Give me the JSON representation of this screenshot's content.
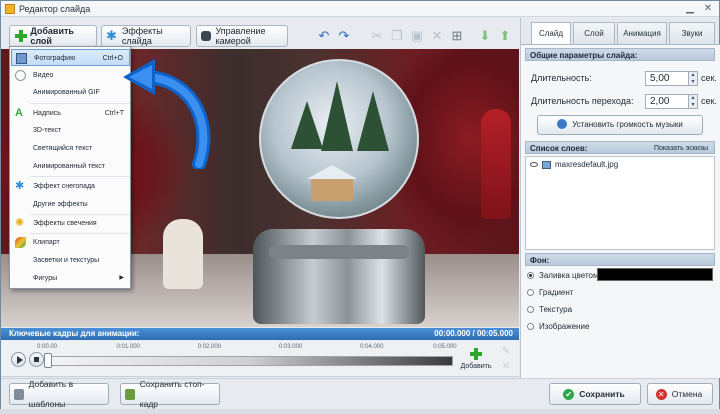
{
  "window": {
    "title": "Редактор слайда"
  },
  "toolbar": {
    "add_layer": "Добавить слой",
    "slide_effects": "Эффекты слайда",
    "camera_control": "Управление камерой"
  },
  "menu": {
    "items": [
      {
        "label": "Фотографию",
        "shortcut": "Ctrl+O",
        "icon": "photo-icon"
      },
      {
        "label": "Видео",
        "shortcut": "",
        "icon": "video-icon"
      },
      {
        "label": "Анимированный GIF",
        "shortcut": "",
        "icon": ""
      },
      {
        "label": "Надпись",
        "shortcut": "Ctrl+T",
        "icon": "text-icon"
      },
      {
        "label": "3D-текст",
        "shortcut": "",
        "icon": ""
      },
      {
        "label": "Светящийся текст",
        "shortcut": "",
        "icon": ""
      },
      {
        "label": "Анимированный текст",
        "shortcut": "",
        "icon": ""
      },
      {
        "label": "Эффект снегопада",
        "shortcut": "",
        "icon": "snowflake-icon"
      },
      {
        "label": "Другие эффекты",
        "shortcut": "",
        "icon": ""
      },
      {
        "label": "Эффекты свечения",
        "shortcut": "",
        "icon": "glow-icon"
      },
      {
        "label": "Клипарт",
        "shortcut": "",
        "icon": "clipart-icon"
      },
      {
        "label": "Засветки и текстуры",
        "shortcut": "",
        "icon": ""
      },
      {
        "label": "Фигуры",
        "shortcut": "",
        "icon": ""
      }
    ]
  },
  "timeline": {
    "header": "Ключевые кадры для анимации:",
    "time": "00:00.000 / 00:05.000",
    "ticks": [
      "0:00.00",
      "0:01.000",
      "0:02.000",
      "0:03.000",
      "0:04.000",
      "0:05.000"
    ],
    "add_label": "Добавить"
  },
  "tabs": [
    "Слайд",
    "Слой",
    "Анимация",
    "Звуки"
  ],
  "slide_params": {
    "header": "Общие параметры слайда:",
    "duration_label": "Длительность:",
    "duration_value": "5,00",
    "transition_label": "Длительность перехода:",
    "transition_value": "2,00",
    "unit": "сек.",
    "music_button": "Установить громкость музыки"
  },
  "layers": {
    "header": "Список слоев:",
    "show_thumbs": "Показать эскизы",
    "items": [
      "maxresdefault.jpg"
    ]
  },
  "background": {
    "header": "Фон:",
    "options": [
      "Заливка цветом",
      "Градиент",
      "Текстура",
      "Изображение"
    ],
    "selected": "Заливка цветом",
    "fill_color": "#000000"
  },
  "bottom": {
    "add_to_templates": "Добавить в шаблоны",
    "save_frame": "Сохранить стоп-кадр",
    "save": "Сохранить",
    "cancel": "Отмена"
  }
}
